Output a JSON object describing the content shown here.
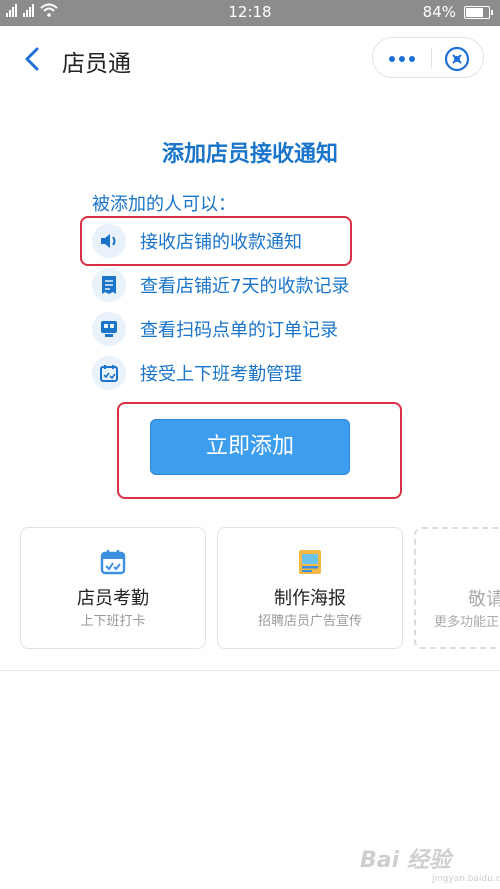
{
  "status_bar": {
    "time": "12:18",
    "battery": "84%",
    "battery_level": 0.84,
    "sim1": "2G",
    "sim2": "4G"
  },
  "header": {
    "title": "店员通"
  },
  "notice": {
    "title": "添加店员接收通知",
    "subtitle": "被添加的人可以：",
    "features": [
      {
        "icon": "speaker-icon",
        "label": "接收店铺的收款通知"
      },
      {
        "icon": "receipt-icon",
        "label": "查看店铺近7天的收款记录"
      },
      {
        "icon": "scan-order-icon",
        "label": "查看扫码点单的订单记录"
      },
      {
        "icon": "calendar-check-icon",
        "label": "接受上下班考勤管理"
      }
    ],
    "add_button": "立即添加"
  },
  "cards": [
    {
      "icon": "attendance-calendar-icon",
      "title": "店员考勤",
      "subtitle": "上下班打卡"
    },
    {
      "icon": "poster-icon",
      "title": "制作海报",
      "subtitle": "招聘店员广告宣传"
    },
    {
      "icon": "",
      "title": "敬请",
      "subtitle": "更多功能正"
    }
  ],
  "watermark": {
    "text": "Bai 经验",
    "sub": "jingyan.baidu.com"
  },
  "colors": {
    "accent": "#1a74c9",
    "button": "#3d9ef0",
    "highlight": "#d92f45",
    "status_bar": "#8c8c8c"
  }
}
